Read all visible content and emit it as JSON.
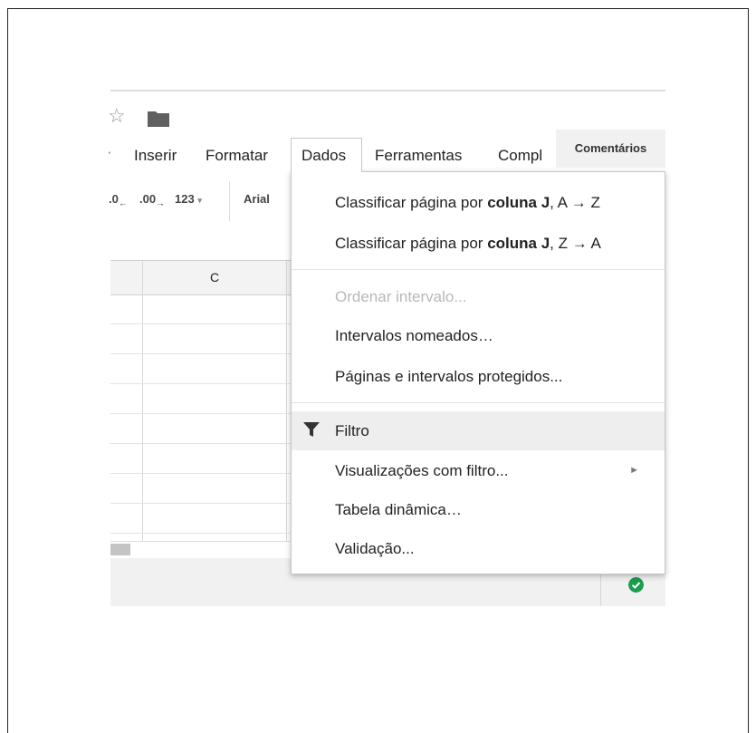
{
  "menubar": {
    "items": [
      "Inserir",
      "Formatar",
      "Dados",
      "Ferramentas",
      "Compl"
    ],
    "comments_label": "Comentários"
  },
  "toolbar": {
    "decrease_decimal": ".0",
    "increase_decimal": ".00",
    "number_format": "123",
    "font_name": "Arial"
  },
  "grid": {
    "column_header": "C"
  },
  "dropdown": {
    "sort_asc": {
      "prefix": "Classificar página por ",
      "bold": "coluna J",
      "suffix": ", A → Z"
    },
    "sort_desc": {
      "prefix": "Classificar página por ",
      "bold": "coluna J",
      "suffix": ", Z → A"
    },
    "sort_range": "Ordenar intervalo...",
    "named_ranges": "Intervalos nomeados…",
    "protected": "Páginas e intervalos protegidos...",
    "filter": "Filtro",
    "filter_views": "Visualizações com filtro...",
    "pivot": "Tabela dinâmica…",
    "validation": "Validação..."
  },
  "icons": [
    "star-icon",
    "folder-icon",
    "filter-icon",
    "submenu-arrow-icon",
    "check-circle-icon"
  ],
  "colors": {
    "accent_green": "#1b9c4f",
    "hover": "#eeeeee"
  }
}
